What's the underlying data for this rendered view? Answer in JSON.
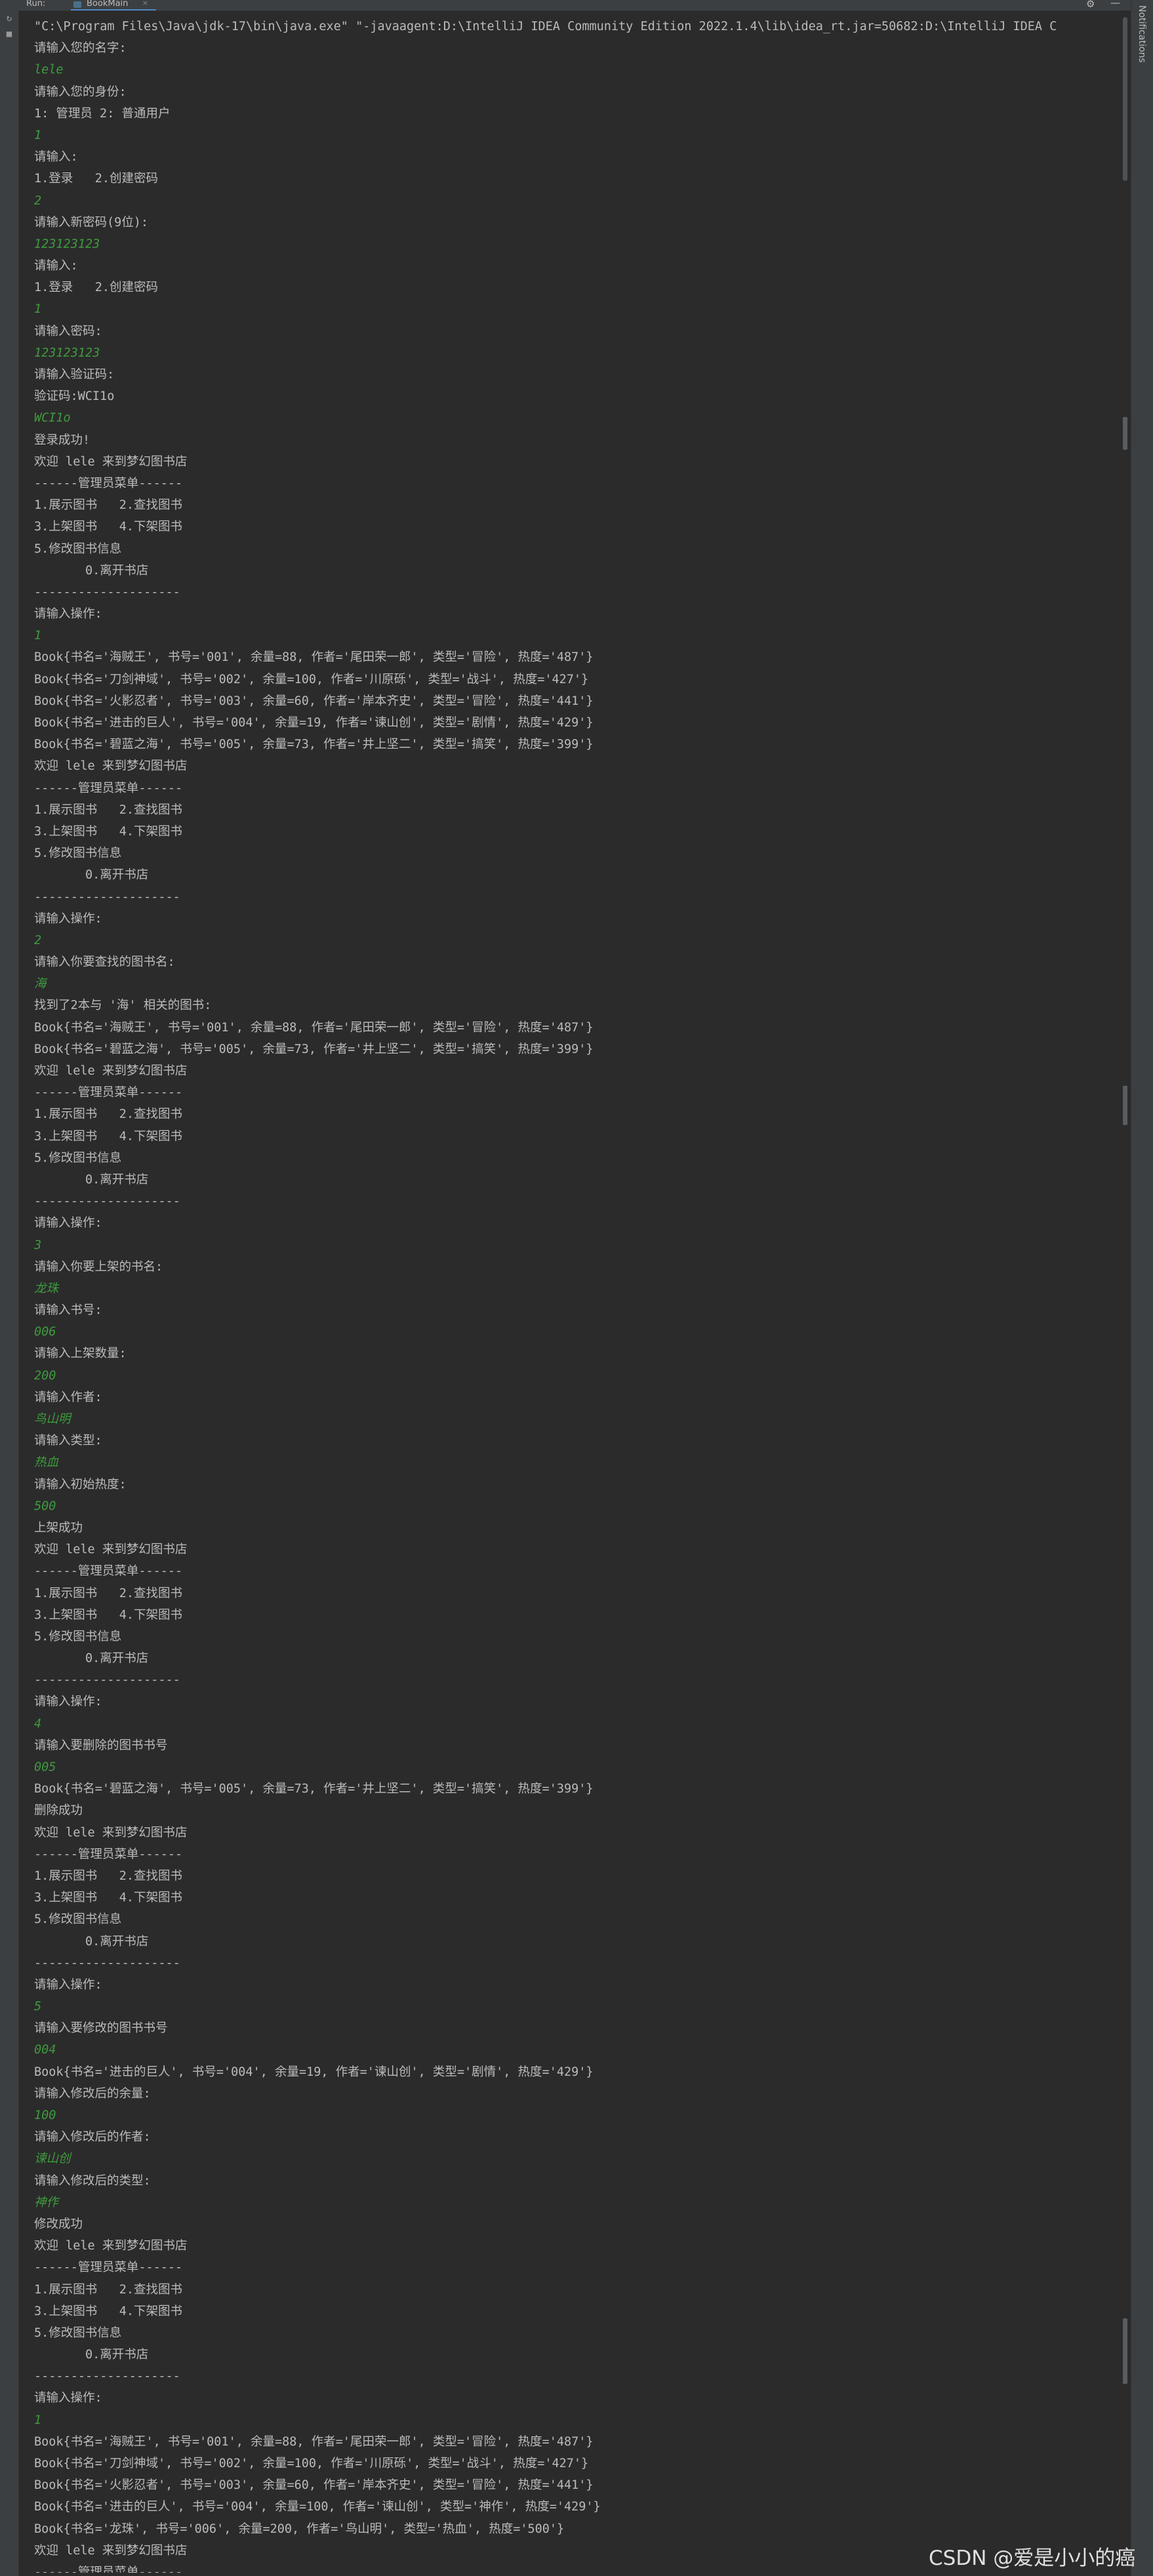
{
  "window": {
    "run_label": "Run:",
    "tab_label": "BookMain",
    "tab_close": "×",
    "settings_icon": "⚙",
    "minimize_icon": "—",
    "right_panel_label": "Notifications"
  },
  "console": {
    "lines": [
      {
        "type": "cmd",
        "text": "\"C:\\Program Files\\Java\\jdk-17\\bin\\java.exe\" \"-javaagent:D:\\IntelliJ IDEA Community Edition 2022.1.4\\lib\\idea_rt.jar=50682:D:\\IntelliJ IDEA C"
      },
      {
        "type": "out",
        "text": "请输入您的名字:"
      },
      {
        "type": "in",
        "text": "lele"
      },
      {
        "type": "out",
        "text": "请输入您的身份:"
      },
      {
        "type": "out",
        "text": "1: 管理员 2: 普通用户"
      },
      {
        "type": "in",
        "text": "1"
      },
      {
        "type": "out",
        "text": "请输入:"
      },
      {
        "type": "out",
        "text": "1.登录   2.创建密码"
      },
      {
        "type": "in",
        "text": "2"
      },
      {
        "type": "out",
        "text": "请输入新密码(9位):"
      },
      {
        "type": "in",
        "text": "123123123"
      },
      {
        "type": "out",
        "text": "请输入:"
      },
      {
        "type": "out",
        "text": "1.登录   2.创建密码"
      },
      {
        "type": "in",
        "text": "1"
      },
      {
        "type": "out",
        "text": "请输入密码:"
      },
      {
        "type": "in",
        "text": "123123123"
      },
      {
        "type": "out",
        "text": "请输入验证码:"
      },
      {
        "type": "out",
        "text": "验证码:WCI1o"
      },
      {
        "type": "in",
        "text": "WCI1o"
      },
      {
        "type": "out",
        "text": "登录成功!"
      },
      {
        "type": "out",
        "text": "欢迎 lele 来到梦幻图书店"
      },
      {
        "type": "out",
        "text": "------管理员菜单------"
      },
      {
        "type": "out",
        "text": "1.展示图书   2.查找图书"
      },
      {
        "type": "out",
        "text": "3.上架图书   4.下架图书"
      },
      {
        "type": "out",
        "text": "5.修改图书信息"
      },
      {
        "type": "out",
        "text": "       0.离开书店"
      },
      {
        "type": "out",
        "text": "--------------------"
      },
      {
        "type": "out",
        "text": "请输入操作:"
      },
      {
        "type": "in",
        "text": "1"
      },
      {
        "type": "out",
        "text": "Book{书名='海贼王', 书号='001', 余量=88, 作者='尾田荣一郎', 类型='冒险', 热度='487'}"
      },
      {
        "type": "out",
        "text": "Book{书名='刀剑神域', 书号='002', 余量=100, 作者='川原砾', 类型='战斗', 热度='427'}"
      },
      {
        "type": "out",
        "text": "Book{书名='火影忍者', 书号='003', 余量=60, 作者='岸本齐史', 类型='冒险', 热度='441'}"
      },
      {
        "type": "out",
        "text": "Book{书名='进击的巨人', 书号='004', 余量=19, 作者='谏山创', 类型='剧情', 热度='429'}"
      },
      {
        "type": "out",
        "text": "Book{书名='碧蓝之海', 书号='005', 余量=73, 作者='井上坚二', 类型='搞笑', 热度='399'}"
      },
      {
        "type": "out",
        "text": "欢迎 lele 来到梦幻图书店"
      },
      {
        "type": "out",
        "text": "------管理员菜单------"
      },
      {
        "type": "out",
        "text": "1.展示图书   2.查找图书"
      },
      {
        "type": "out",
        "text": "3.上架图书   4.下架图书"
      },
      {
        "type": "out",
        "text": "5.修改图书信息"
      },
      {
        "type": "out",
        "text": "       0.离开书店"
      },
      {
        "type": "out",
        "text": "--------------------"
      },
      {
        "type": "out",
        "text": "请输入操作:"
      },
      {
        "type": "in",
        "text": "2"
      },
      {
        "type": "out",
        "text": "请输入你要查找的图书名:"
      },
      {
        "type": "in",
        "text": "海"
      },
      {
        "type": "out",
        "text": "找到了2本与 '海' 相关的图书:"
      },
      {
        "type": "out",
        "text": "Book{书名='海贼王', 书号='001', 余量=88, 作者='尾田荣一郎', 类型='冒险', 热度='487'}"
      },
      {
        "type": "out",
        "text": "Book{书名='碧蓝之海', 书号='005', 余量=73, 作者='井上坚二', 类型='搞笑', 热度='399'}"
      },
      {
        "type": "out",
        "text": "欢迎 lele 来到梦幻图书店"
      },
      {
        "type": "out",
        "text": "------管理员菜单------"
      },
      {
        "type": "out",
        "text": "1.展示图书   2.查找图书"
      },
      {
        "type": "out",
        "text": "3.上架图书   4.下架图书"
      },
      {
        "type": "out",
        "text": "5.修改图书信息"
      },
      {
        "type": "out",
        "text": "       0.离开书店"
      },
      {
        "type": "out",
        "text": "--------------------"
      },
      {
        "type": "out",
        "text": "请输入操作:"
      },
      {
        "type": "in",
        "text": "3"
      },
      {
        "type": "out",
        "text": "请输入你要上架的书名:"
      },
      {
        "type": "in",
        "text": "龙珠"
      },
      {
        "type": "out",
        "text": "请输入书号:"
      },
      {
        "type": "in",
        "text": "006"
      },
      {
        "type": "out",
        "text": "请输入上架数量:"
      },
      {
        "type": "in",
        "text": "200"
      },
      {
        "type": "out",
        "text": "请输入作者:"
      },
      {
        "type": "in",
        "text": "鸟山明"
      },
      {
        "type": "out",
        "text": "请输入类型:"
      },
      {
        "type": "in",
        "text": "热血"
      },
      {
        "type": "out",
        "text": "请输入初始热度:"
      },
      {
        "type": "in",
        "text": "500"
      },
      {
        "type": "out",
        "text": "上架成功"
      },
      {
        "type": "out",
        "text": "欢迎 lele 来到梦幻图书店"
      },
      {
        "type": "out",
        "text": "------管理员菜单------"
      },
      {
        "type": "out",
        "text": "1.展示图书   2.查找图书"
      },
      {
        "type": "out",
        "text": "3.上架图书   4.下架图书"
      },
      {
        "type": "out",
        "text": "5.修改图书信息"
      },
      {
        "type": "out",
        "text": "       0.离开书店"
      },
      {
        "type": "out",
        "text": "--------------------"
      },
      {
        "type": "out",
        "text": "请输入操作:"
      },
      {
        "type": "in",
        "text": "4"
      },
      {
        "type": "out",
        "text": "请输入要删除的图书书号"
      },
      {
        "type": "in",
        "text": "005"
      },
      {
        "type": "out",
        "text": "Book{书名='碧蓝之海', 书号='005', 余量=73, 作者='井上坚二', 类型='搞笑', 热度='399'}"
      },
      {
        "type": "out",
        "text": "删除成功"
      },
      {
        "type": "out",
        "text": "欢迎 lele 来到梦幻图书店"
      },
      {
        "type": "out",
        "text": "------管理员菜单------"
      },
      {
        "type": "out",
        "text": "1.展示图书   2.查找图书"
      },
      {
        "type": "out",
        "text": "3.上架图书   4.下架图书"
      },
      {
        "type": "out",
        "text": "5.修改图书信息"
      },
      {
        "type": "out",
        "text": "       0.离开书店"
      },
      {
        "type": "out",
        "text": "--------------------"
      },
      {
        "type": "out",
        "text": "请输入操作:"
      },
      {
        "type": "in",
        "text": "5"
      },
      {
        "type": "out",
        "text": "请输入要修改的图书书号"
      },
      {
        "type": "in",
        "text": "004"
      },
      {
        "type": "out",
        "text": "Book{书名='进击的巨人', 书号='004', 余量=19, 作者='谏山创', 类型='剧情', 热度='429'}"
      },
      {
        "type": "out",
        "text": "请输入修改后的余量:"
      },
      {
        "type": "in",
        "text": "100"
      },
      {
        "type": "out",
        "text": "请输入修改后的作者:"
      },
      {
        "type": "in",
        "text": "谏山创"
      },
      {
        "type": "out",
        "text": "请输入修改后的类型:"
      },
      {
        "type": "in",
        "text": "神作"
      },
      {
        "type": "out",
        "text": "修改成功"
      },
      {
        "type": "out",
        "text": "欢迎 lele 来到梦幻图书店"
      },
      {
        "type": "out",
        "text": "------管理员菜单------"
      },
      {
        "type": "out",
        "text": "1.展示图书   2.查找图书"
      },
      {
        "type": "out",
        "text": "3.上架图书   4.下架图书"
      },
      {
        "type": "out",
        "text": "5.修改图书信息"
      },
      {
        "type": "out",
        "text": "       0.离开书店"
      },
      {
        "type": "out",
        "text": "--------------------"
      },
      {
        "type": "out",
        "text": "请输入操作:"
      },
      {
        "type": "in",
        "text": "1"
      },
      {
        "type": "out",
        "text": "Book{书名='海贼王', 书号='001', 余量=88, 作者='尾田荣一郎', 类型='冒险', 热度='487'}"
      },
      {
        "type": "out",
        "text": "Book{书名='刀剑神域', 书号='002', 余量=100, 作者='川原砾', 类型='战斗', 热度='427'}"
      },
      {
        "type": "out",
        "text": "Book{书名='火影忍者', 书号='003', 余量=60, 作者='岸本齐史', 类型='冒险', 热度='441'}"
      },
      {
        "type": "out",
        "text": "Book{书名='进击的巨人', 书号='004', 余量=100, 作者='谏山创', 类型='神作', 热度='429'}"
      },
      {
        "type": "out",
        "text": "Book{书名='龙珠', 书号='006', 余量=200, 作者='鸟山明', 类型='热血', 热度='500'}"
      },
      {
        "type": "out",
        "text": "欢迎 lele 来到梦幻图书店"
      },
      {
        "type": "out",
        "text": "------管理员菜单------"
      }
    ]
  },
  "watermark": "CSDN @爱是小小的癌",
  "colors": {
    "background": "#2b2b2b",
    "output_text": "#bbbbbb",
    "user_input": "#3e9b3e",
    "tool_window": "#3c3f41"
  }
}
